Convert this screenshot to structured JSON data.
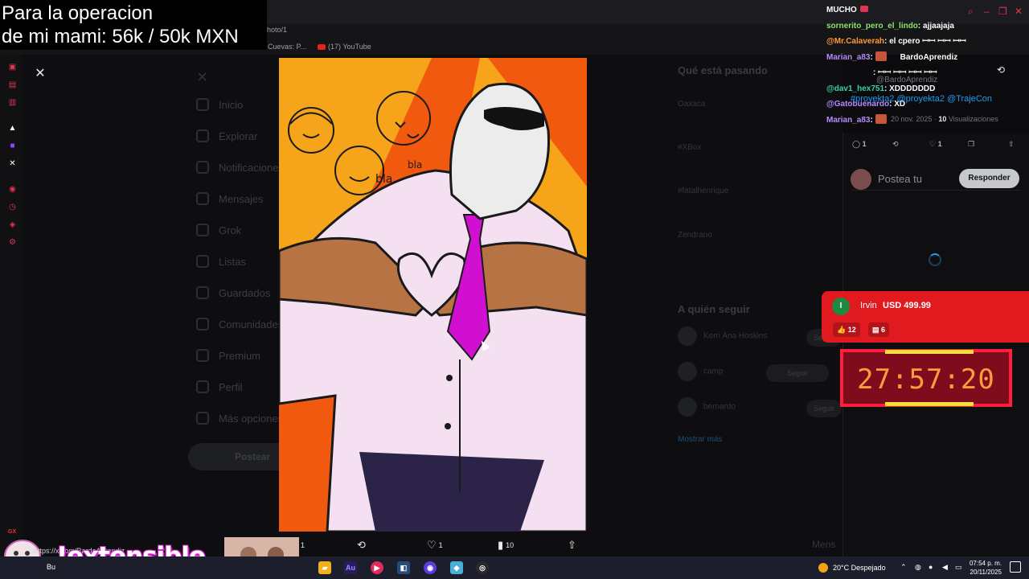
{
  "goal_overlay": {
    "line1": "Para la operacion",
    "line2": "de mi mami: 56k / 50k MXN"
  },
  "browser": {
    "url_fragment": "hoto/1",
    "bookmarks": [
      "Cuevas: P...",
      "(17) YouTube"
    ]
  },
  "twitter_nav": {
    "items": [
      "Inicio",
      "Explorar",
      "Notificaciones",
      "Mensajes",
      "Grok",
      "Listas",
      "Guardados",
      "Comunidades",
      "Premium",
      "Perfil",
      "Más opciones"
    ],
    "post_button": "Postear"
  },
  "twitter_right": {
    "whats_happening": "Qué está pasando",
    "trends": [
      "Oaxaca",
      "#XBox",
      "#fatalhenrique",
      "Zendrano"
    ],
    "who_to_follow": "A quién seguir",
    "follow_rows": [
      "Kerri Ana Hoskins",
      "camp",
      "bernardo"
    ],
    "follow_labels": [
      "Seguir",
      "Seguir",
      "Seguir"
    ],
    "show_more": "Mostrar más",
    "messages": "Mens"
  },
  "photo_viewer": {
    "close_icon": "close-icon",
    "actions": {
      "replies": "1",
      "reposts": "",
      "likes": "1",
      "views": "10"
    }
  },
  "chat": {
    "header_tail": "MUCHO",
    "messages": [
      {
        "user": "sornerito_pero_el_lindo",
        "text": ": ajjaajaja",
        "color_class": "u1"
      },
      {
        "user": "@Mr.Calaverah",
        "text": ": el cpero ꟷꟷ ꟷꟷ ꟷꟷ",
        "color_class": "u2"
      },
      {
        "user": "Marian_a83",
        "text": ":",
        "color_class": "u3"
      },
      {
        "user": "",
        "text": ": ꟷꟷ ꟷꟷ ꟷꟷ ꟷꟷ",
        "color_class": "u4"
      },
      {
        "user": "@dav1_hex751",
        "text": ": XDDDDDDD",
        "color_class": "u4"
      },
      {
        "user": "@Gatobuenardo",
        "text": ": XD",
        "color_class": "u3"
      },
      {
        "user": "Marian_a83",
        "text": ":",
        "color_class": "u3"
      }
    ],
    "mini_user": "BardoAprendiz"
  },
  "tweet": {
    "handle": "@BardoAprendiz",
    "tagline": "#proyekta2 @proyekta2 @TrajeCon",
    "date": "20 nov. 2025",
    "views_count": "10",
    "views_label": "Visualizaciones",
    "replies": "1",
    "likes": "1",
    "reply_placeholder": "Postea tu",
    "reply_button": "Responder"
  },
  "donation": {
    "initial": "I",
    "name": "Irvin",
    "amount": "USD 499.99",
    "likes": "12",
    "comments": "6"
  },
  "timer": {
    "value": "27:57:20"
  },
  "stream_overlay": {
    "link": "https://x.com/BardoAprendiz",
    "brand": "!extensible"
  },
  "taskbar": {
    "search_text": "Bu",
    "weather": "20°C  Despejado",
    "time": "07:54 p. m.",
    "date": "20/11/2025",
    "app_labels": [
      "Au"
    ]
  },
  "colors": {
    "accent_blue": "#1d9bf0",
    "donation_red": "#e01a1f",
    "timer_orange": "#ff9a3d",
    "timer_border": "#ff1f3d"
  }
}
